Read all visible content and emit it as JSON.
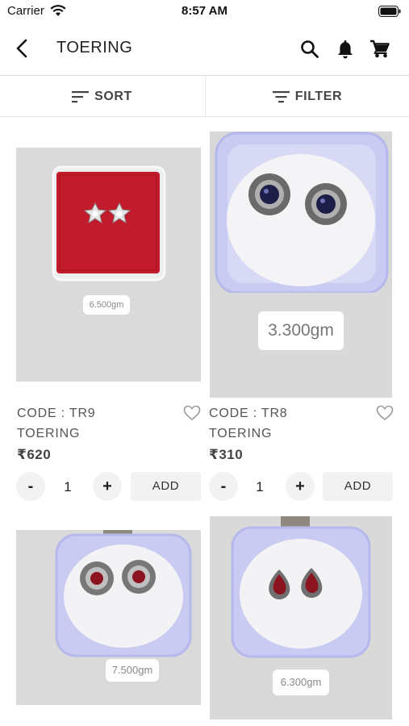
{
  "status_bar": {
    "carrier": "Carrier",
    "time": "8:57 AM"
  },
  "header": {
    "title": "TOERING"
  },
  "toolbar": {
    "sort_label": "SORT",
    "filter_label": "FILTER"
  },
  "products": [
    {
      "weight": "6.500gm",
      "code": "CODE : TR9",
      "category": "TOERING",
      "price": "₹620",
      "qty": "1",
      "minus": "-",
      "plus": "+",
      "add": "ADD"
    },
    {
      "weight": "3.300gm",
      "code": "CODE : TR8",
      "category": "TOERING",
      "price": "₹310",
      "qty": "1",
      "minus": "-",
      "plus": "+",
      "add": "ADD"
    },
    {
      "weight": "7.500gm"
    },
    {
      "weight": "6.300gm"
    }
  ],
  "colors": {
    "velvet_red": "#c21b2d",
    "acrylic_box": "#c7c8f0",
    "background_grey": "#dedede"
  }
}
